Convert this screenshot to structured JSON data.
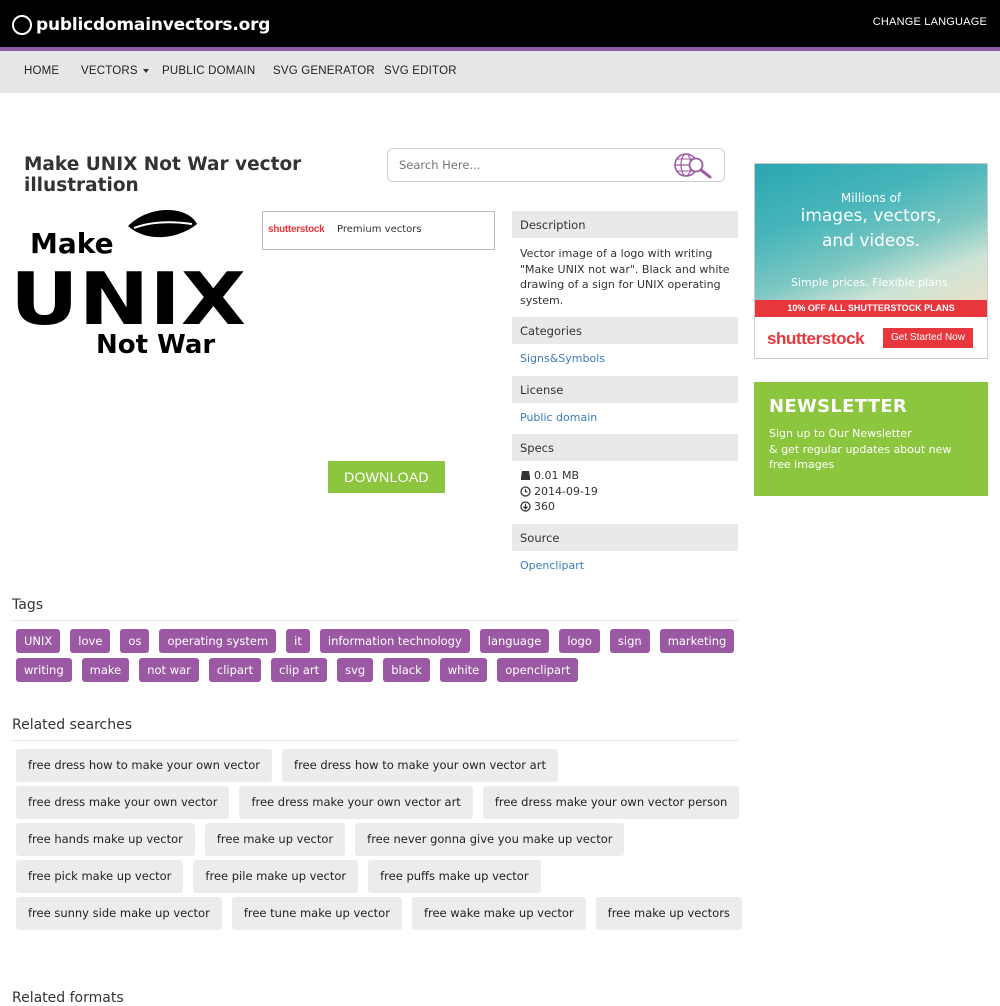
{
  "header": {
    "site_name": "publicdomainvectors.org",
    "change_language": "CHANGE LANGUAGE"
  },
  "nav": {
    "items": [
      {
        "label": "HOME"
      },
      {
        "label": "VECTORS"
      },
      {
        "label": "PUBLIC DOMAIN"
      },
      {
        "label": "SVG GENERATOR"
      },
      {
        "label": "SVG EDITOR"
      }
    ]
  },
  "page": {
    "title": "Make UNIX Not War vector illustration"
  },
  "search": {
    "placeholder": "Search Here..."
  },
  "image": {
    "line1": "Make",
    "line2": "UNIX",
    "line3": "Not War"
  },
  "premium": {
    "brand": "shutterstock",
    "label": "Premium vectors"
  },
  "download": {
    "label": "DOWNLOAD"
  },
  "info": {
    "description_heading": "Description",
    "description": "Vector image of a logo with writing \"Make UNIX not war\". Black and white drawing of a sign for UNIX operating system.",
    "categories_heading": "Categories",
    "category": "Signs&Symbols",
    "license_heading": "License",
    "license": "Public domain",
    "specs_heading": "Specs",
    "size": "0.01 MB",
    "date": "2014-09-19",
    "downloads": "360",
    "source_heading": "Source",
    "source": "Openclipart"
  },
  "ad": {
    "line1": "Millions of",
    "line2": "images, vectors,",
    "line3": "and videos.",
    "line4": "Simple prices. Flexible plans.",
    "strip": "10% OFF ALL SHUTTERSTOCK PLANS",
    "brand": "shutterstock",
    "cta": "Get Started Now"
  },
  "newsletter": {
    "title": "NEWSLETTER",
    "line1": "Sign up to Our Newsletter",
    "line2": "& get regular updates about new free images"
  },
  "tags": {
    "title": "Tags",
    "items": [
      "UNIX",
      "love",
      "os",
      "operating system",
      "it",
      "information technology",
      "language",
      "logo",
      "sign",
      "marketing",
      "writing",
      "make",
      "not war",
      "clipart",
      "clip art",
      "svg",
      "black",
      "white",
      "openclipart"
    ]
  },
  "related": {
    "title": "Related searches",
    "items": [
      "free dress how to make your own vector",
      "free dress how to make your own vector art",
      "free dress make your own vector",
      "free dress make your own vector art",
      "free dress make your own vector person",
      "free hands make up vector",
      "free make up vector",
      "free never gonna give you make up vector",
      "free pick make up vector",
      "free pile make up vector",
      "free puffs make up vector",
      "free sunny side make up vector",
      "free tune make up vector",
      "free wake make up vector",
      "free make up vectors"
    ]
  },
  "related_footer": {
    "title": "Related formats"
  },
  "colors": {
    "accent_purple": "#9b59a3",
    "accent_green": "#8cc63e",
    "link_blue": "#3a7bbf",
    "ad_red": "#e8363d"
  }
}
